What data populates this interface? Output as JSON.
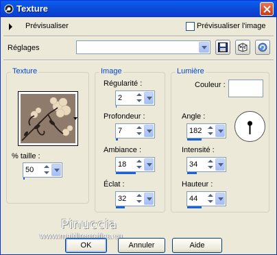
{
  "window": {
    "title": "Texture",
    "title_icon": "psp-app-icon",
    "close_icon": "close-icon"
  },
  "preview": {
    "toggle_label": "Prévisualiser",
    "checkbox_label": "Prévisualiser l'image",
    "checkbox_checked": false
  },
  "presets": {
    "label": "Réglages",
    "value": ""
  },
  "texture_group": {
    "title": "Texture",
    "size_label": "% taille :",
    "size_value": "50",
    "size_fraction": 0.05
  },
  "image_group": {
    "title": "Image",
    "fields": [
      {
        "label": "Régularité :",
        "value": "2",
        "fraction": 0.02
      },
      {
        "label": "Profondeur :",
        "value": "7",
        "fraction": 0.07
      },
      {
        "label": "Ambiance :",
        "value": "18",
        "fraction": 0.7
      },
      {
        "label": "Éclat :",
        "value": "32",
        "fraction": 0.3
      }
    ]
  },
  "light_group": {
    "title": "Lumière",
    "color_label": "Couleur :",
    "color_value": "#ffffff",
    "fields": [
      {
        "label": "Angle :",
        "value": "182",
        "fraction": 0.5
      },
      {
        "label": "Intensité :",
        "value": "34",
        "fraction": 0.34
      },
      {
        "label": "Hauteur :",
        "value": "44",
        "fraction": 0.5
      }
    ]
  },
  "watermark": {
    "name": "Pinuccia",
    "url": "www.maidiregrafica.eu"
  },
  "buttons": {
    "ok": "OK",
    "cancel": "Annuler",
    "help": "Aide"
  },
  "colors": {
    "title_bar": "#0c4ad8",
    "dialog_bg": "#ece9d8",
    "group_title": "#0046d5",
    "accent": "#1a63d6"
  }
}
